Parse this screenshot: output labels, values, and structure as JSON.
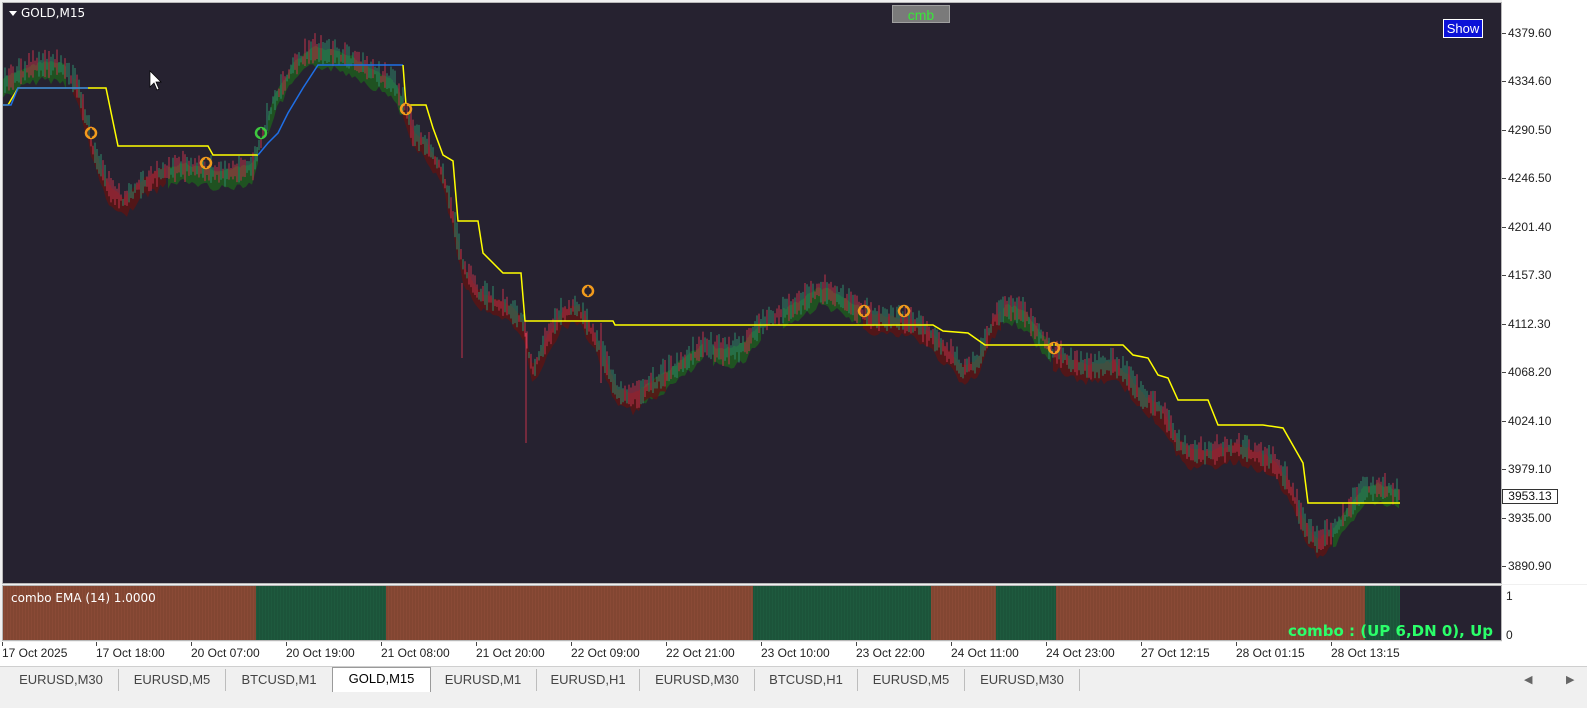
{
  "chart": {
    "title": "GOLD,M15",
    "cmb_button": "cmb",
    "show_button": "Show",
    "current_price": "3953.13",
    "price_ticks": [
      "4379.60",
      "4334.60",
      "4290.50",
      "4246.50",
      "4201.40",
      "4157.30",
      "4112.30",
      "4068.20",
      "4024.10",
      "3979.10",
      "3935.00",
      "3890.90"
    ],
    "time_labels": [
      "17 Oct 2025",
      "17 Oct 18:00",
      "20 Oct 07:00",
      "20 Oct 19:00",
      "21 Oct 08:00",
      "21 Oct 20:00",
      "22 Oct 09:00",
      "22 Oct 21:00",
      "23 Oct 10:00",
      "23 Oct 22:00",
      "24 Oct 11:00",
      "24 Oct 23:00",
      "27 Oct 12:15",
      "28 Oct 01:15",
      "28 Oct 13:15"
    ],
    "colors": {
      "background": "#262230",
      "stop_line": "#ffff00",
      "stop_line_up": "#1f6fe6",
      "cloud_up": "#1f5a1f",
      "cloud_down": "#5a1414",
      "candle_up": "#2e8b6a",
      "candle_down": "#c0334a",
      "signal_marker": "#f29b1c",
      "signal_marker_up": "#3ec83e"
    }
  },
  "indicator": {
    "label": "combo EMA (14) 1.0000",
    "status": "combo : (UP 6,DN 0), Up",
    "axis_ticks": [
      "1",
      "0"
    ],
    "colors": {
      "up": "#1e5a3e",
      "down": "#8a4a36"
    }
  },
  "tabs": [
    {
      "label": "EURUSD,M30",
      "active": false
    },
    {
      "label": "EURUSD,M5",
      "active": false
    },
    {
      "label": "BTCUSD,M1",
      "active": false
    },
    {
      "label": "GOLD,M15",
      "active": true
    },
    {
      "label": "EURUSD,M1",
      "active": false
    },
    {
      "label": "EURUSD,H1",
      "active": false
    },
    {
      "label": "EURUSD,M30",
      "active": false
    },
    {
      "label": "BTCUSD,H1",
      "active": false
    },
    {
      "label": "EURUSD,M5",
      "active": false
    },
    {
      "label": "EURUSD,M30",
      "active": false
    }
  ],
  "nav": {
    "left": "◀",
    "right": "▶"
  }
}
